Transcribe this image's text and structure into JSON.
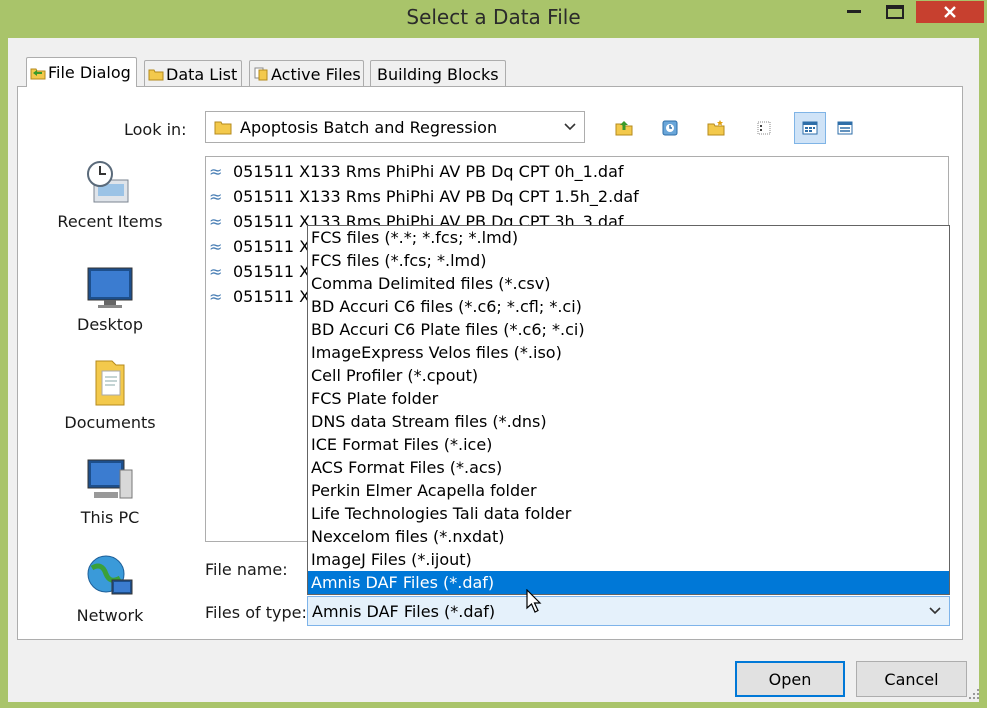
{
  "window": {
    "title": "Select a Data File",
    "accent_color": "#a9c46a",
    "close_color": "#c7402f"
  },
  "tabs": [
    {
      "label": "File Dialog",
      "icon": "folder-open-icon",
      "active": true
    },
    {
      "label": "Data List",
      "icon": "folder-icon",
      "active": false
    },
    {
      "label": "Active Files",
      "icon": "files-icon",
      "active": false
    },
    {
      "label": "Building Blocks",
      "icon": "",
      "active": false
    }
  ],
  "look_in": {
    "label": "Look in:",
    "value": "Apoptosis Batch and Regression"
  },
  "toolbar": {
    "icons": [
      "up-folder-icon",
      "recent-icon",
      "new-folder-icon",
      "details-view-icon",
      "icon-view-icon",
      "list-view-icon"
    ]
  },
  "places": [
    {
      "label": "Recent Items",
      "icon": "recent-items-icon"
    },
    {
      "label": "Desktop",
      "icon": "desktop-icon"
    },
    {
      "label": "Documents",
      "icon": "documents-icon"
    },
    {
      "label": "This PC",
      "icon": "computer-icon"
    },
    {
      "label": "Network",
      "icon": "network-icon"
    }
  ],
  "files": [
    "051511 X133 Rms PhiPhi AV PB Dq CPT 0h_1.daf",
    "051511 X133 Rms PhiPhi AV PB Dq CPT 1.5h_2.daf",
    "051511 X133 Rms PhiPhi AV PB Dq CPT 3h_3.daf",
    "051511 X1",
    "051511 X1",
    "051511 X1"
  ],
  "file_name": {
    "label": "File name:",
    "value": ""
  },
  "file_type": {
    "label": "Files of type:",
    "value": "Amnis DAF Files (*.daf)",
    "options": [
      "FCS files (*.*; *.fcs; *.lmd)",
      "FCS files (*.fcs; *.lmd)",
      "Comma Delimited files (*.csv)",
      "BD Accuri C6 files (*.c6; *.cfl; *.ci)",
      "BD Accuri C6 Plate files (*.c6; *.ci)",
      "ImageExpress Velos files (*.iso)",
      "Cell Profiler (*.cpout)",
      "FCS Plate folder",
      "DNS data Stream files (*.dns)",
      "ICE Format Files (*.ice)",
      "ACS Format Files (*.acs)",
      "Perkin Elmer Acapella folder",
      "Life Technologies Tali data folder",
      "Nexcelom files (*.nxdat)",
      "ImageJ Files (*.ijout)",
      "Amnis DAF Files (*.daf)"
    ],
    "selected_index": 15
  },
  "buttons": {
    "open": "Open",
    "cancel": "Cancel"
  }
}
